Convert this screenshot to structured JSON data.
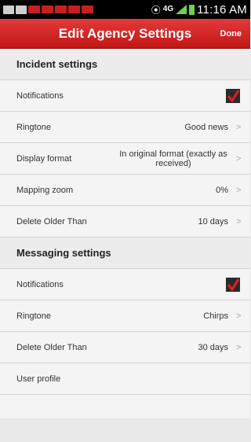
{
  "status_bar": {
    "network": "4G",
    "time": "11:16 AM"
  },
  "header": {
    "title": "Edit Agency Settings",
    "done_label": "Done"
  },
  "incident": {
    "title": "Incident settings",
    "notifications_label": "Notifications",
    "notifications_checked": true,
    "ringtone_label": "Ringtone",
    "ringtone_value": "Good news",
    "display_format_label": "Display format",
    "display_format_value": "In original format (exactly as received)",
    "mapping_zoom_label": "Mapping zoom",
    "mapping_zoom_value": "0%",
    "delete_older_label": "Delete Older Than",
    "delete_older_value": "10 days"
  },
  "messaging": {
    "title": "Messaging settings",
    "notifications_label": "Notifications",
    "notifications_checked": true,
    "ringtone_label": "Ringtone",
    "ringtone_value": "Chirps",
    "delete_older_label": "Delete Older Than",
    "delete_older_value": "30 days"
  },
  "user_profile_label": "User profile",
  "colors": {
    "header_red": "#d12a2a",
    "check_red": "#e01e1e"
  }
}
